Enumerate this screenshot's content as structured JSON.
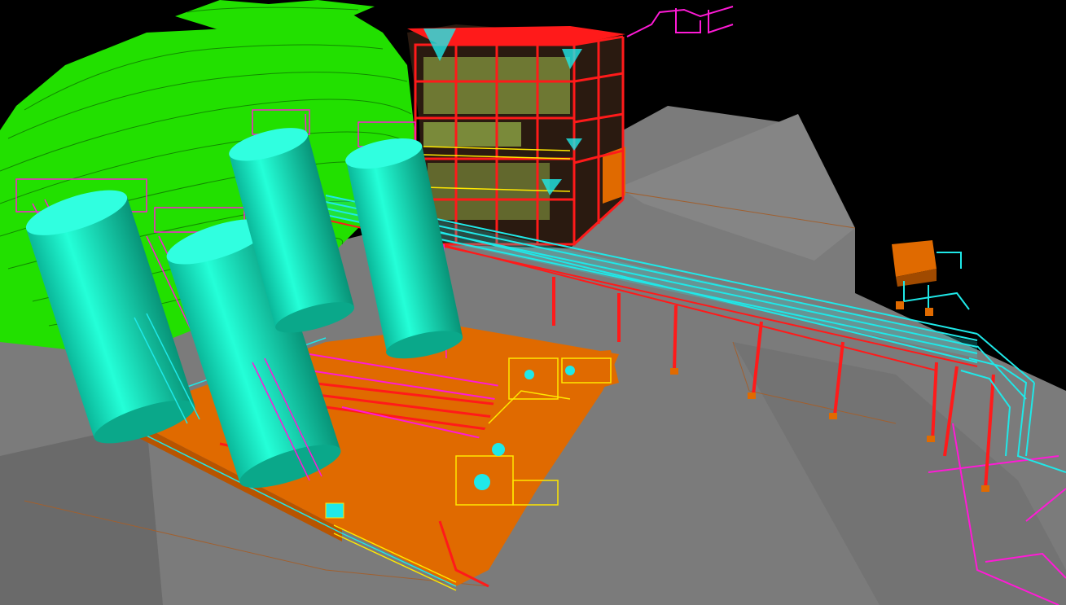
{
  "viewer": {
    "view": "3D plant model",
    "background": "#000000"
  },
  "palette": {
    "terrain_green": "#22e000",
    "ground_gray": "#7b7b7b",
    "ground_gray_dark": "#6a6a6a",
    "tank_cyan": "#14f0c8",
    "pipe_cyan": "#1fe8e8",
    "platform_orange": "#e06a00",
    "steel_red": "#ff1a1a",
    "handrail_yellow": "#ffe800",
    "pipe_magenta": "#ff1ad6",
    "equipment_olive": "#7a8a3a"
  },
  "scene": {
    "objects": [
      {
        "name": "terrain-contours",
        "kind": "terrain"
      },
      {
        "name": "ground-pad",
        "kind": "ground"
      },
      {
        "name": "process-building",
        "kind": "structure"
      },
      {
        "name": "pipe-rack",
        "kind": "pipe-rack"
      },
      {
        "name": "storage-tank-1",
        "kind": "vessel"
      },
      {
        "name": "storage-tank-2",
        "kind": "vessel"
      },
      {
        "name": "storage-tank-3",
        "kind": "vessel"
      },
      {
        "name": "storage-tank-4",
        "kind": "vessel"
      },
      {
        "name": "tank-farm-platform",
        "kind": "platform"
      },
      {
        "name": "pump-skid-platform",
        "kind": "platform"
      },
      {
        "name": "remote-equipment-skid",
        "kind": "equipment"
      },
      {
        "name": "magenta-pipe-run",
        "kind": "piping"
      }
    ]
  }
}
